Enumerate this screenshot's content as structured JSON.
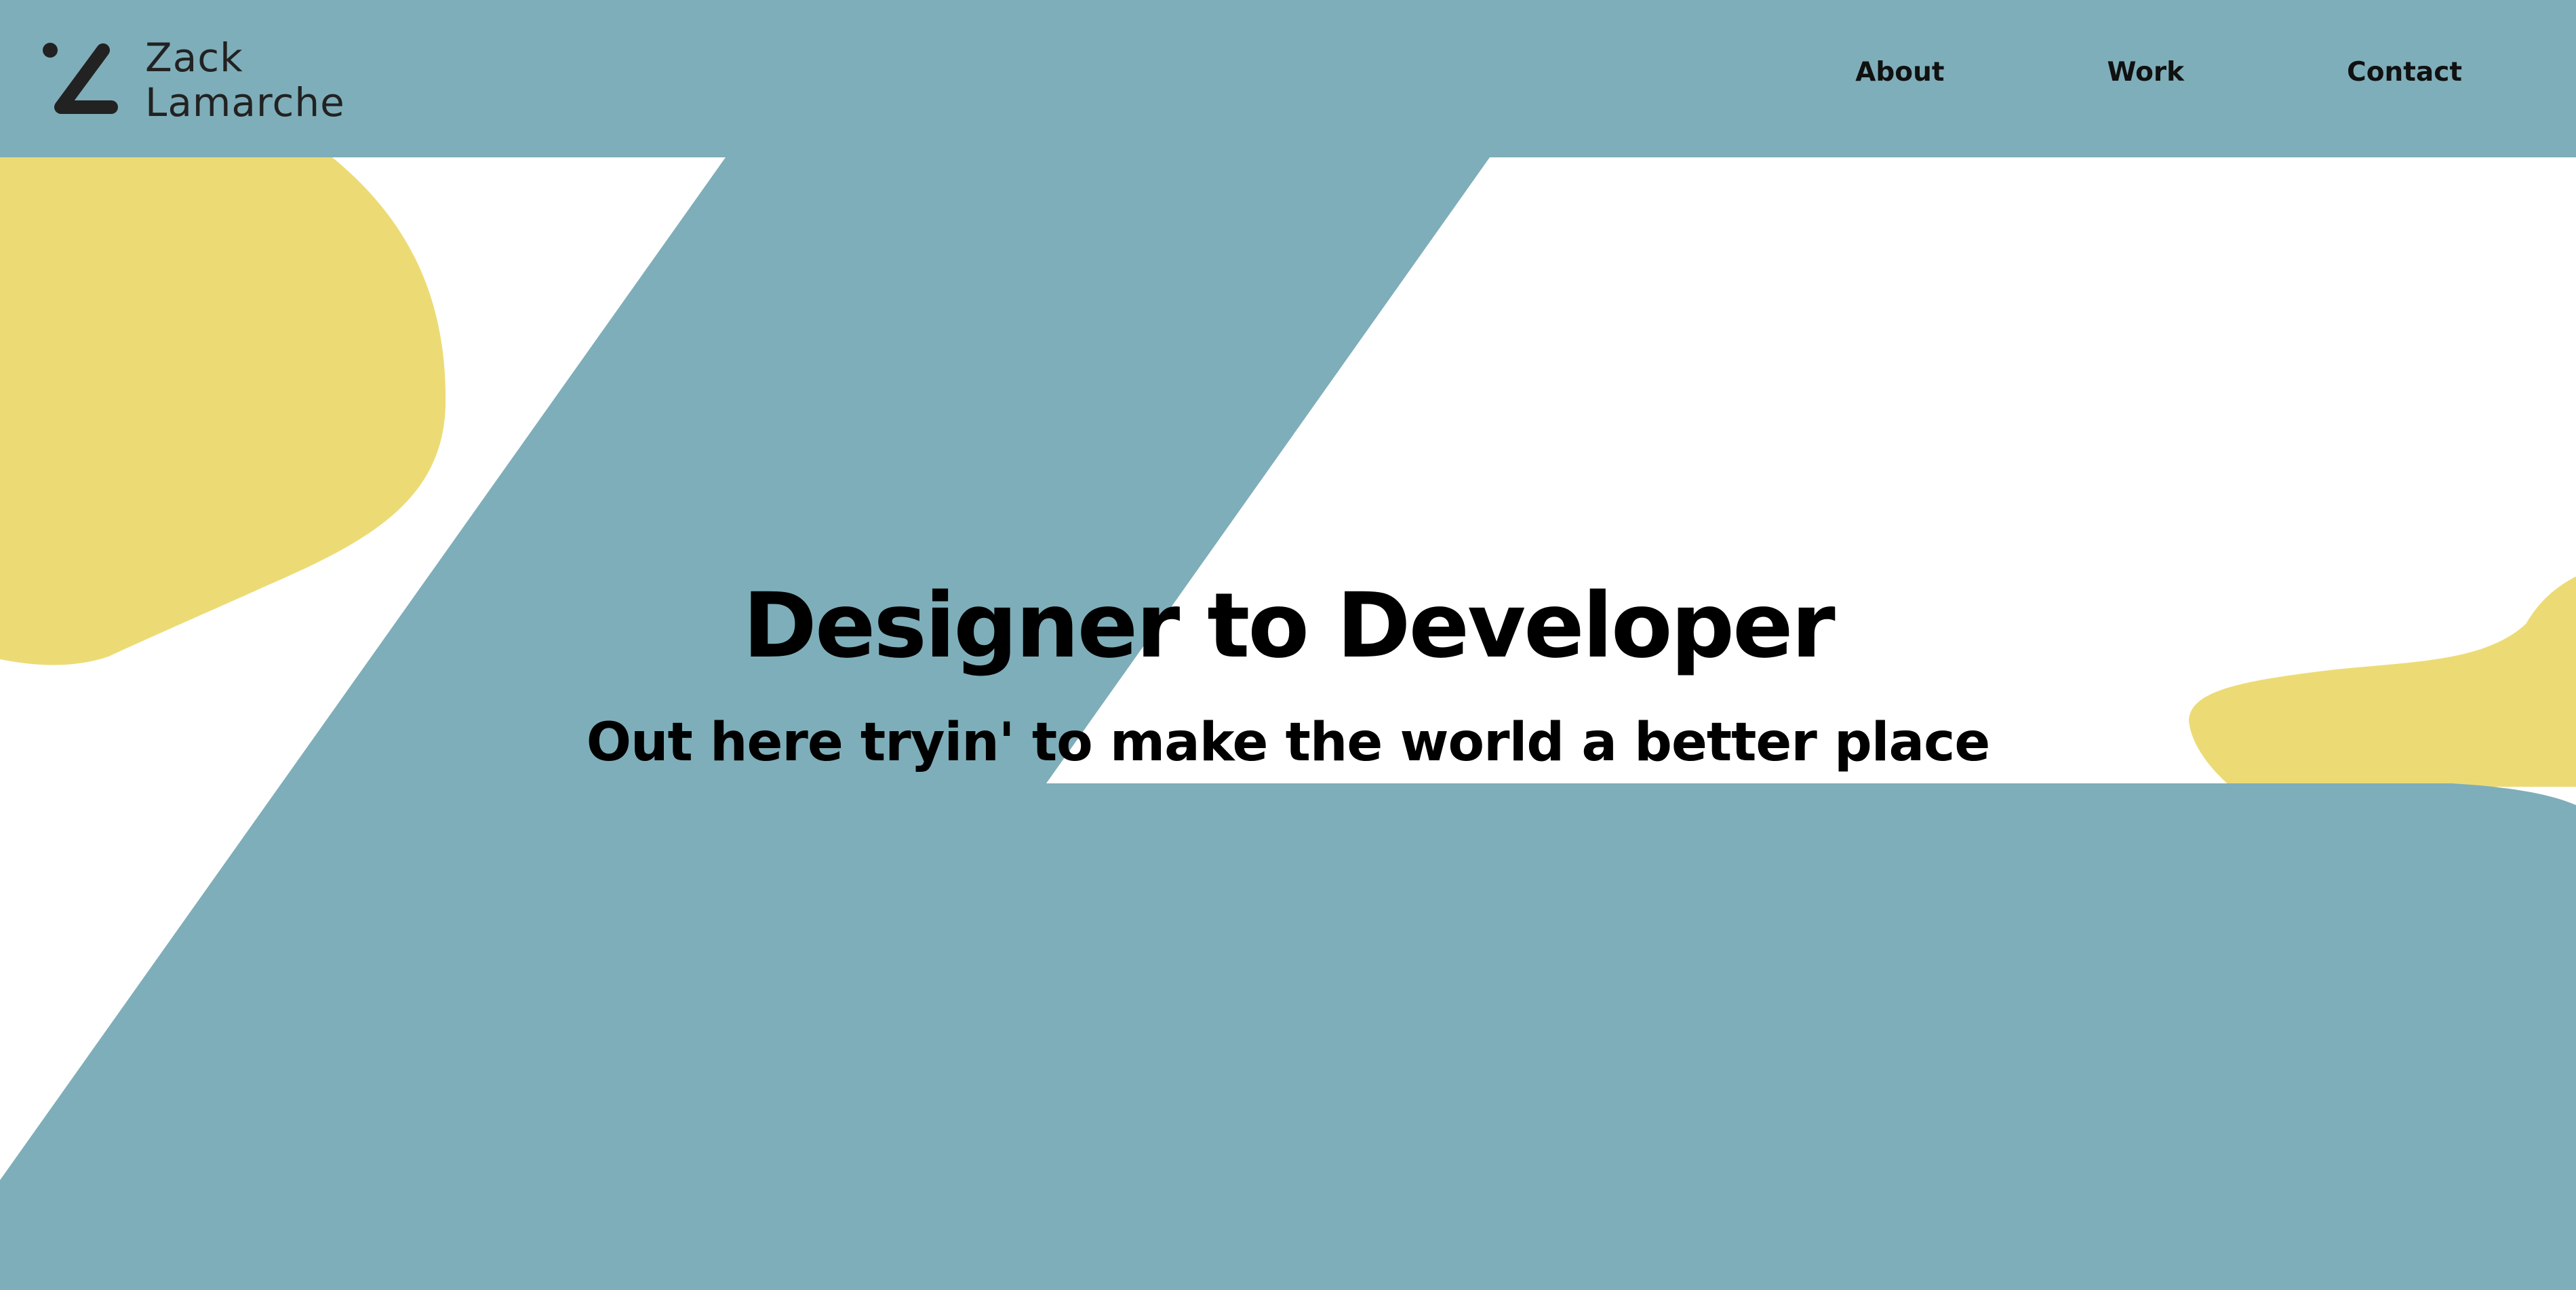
{
  "colors": {
    "primary": "#7eaeb9",
    "accent": "#ecdb75",
    "background": "#ffffff",
    "text": "#000000"
  },
  "header": {
    "logo_icon": "zl-monogram-icon",
    "brand_first": "Zack",
    "brand_last": "Lamarche",
    "nav": [
      {
        "label": "About"
      },
      {
        "label": "Work"
      },
      {
        "label": "Contact"
      }
    ]
  },
  "hero": {
    "title": "Designer to Developer",
    "subtitle": "Out here tryin' to make the world a better place"
  }
}
